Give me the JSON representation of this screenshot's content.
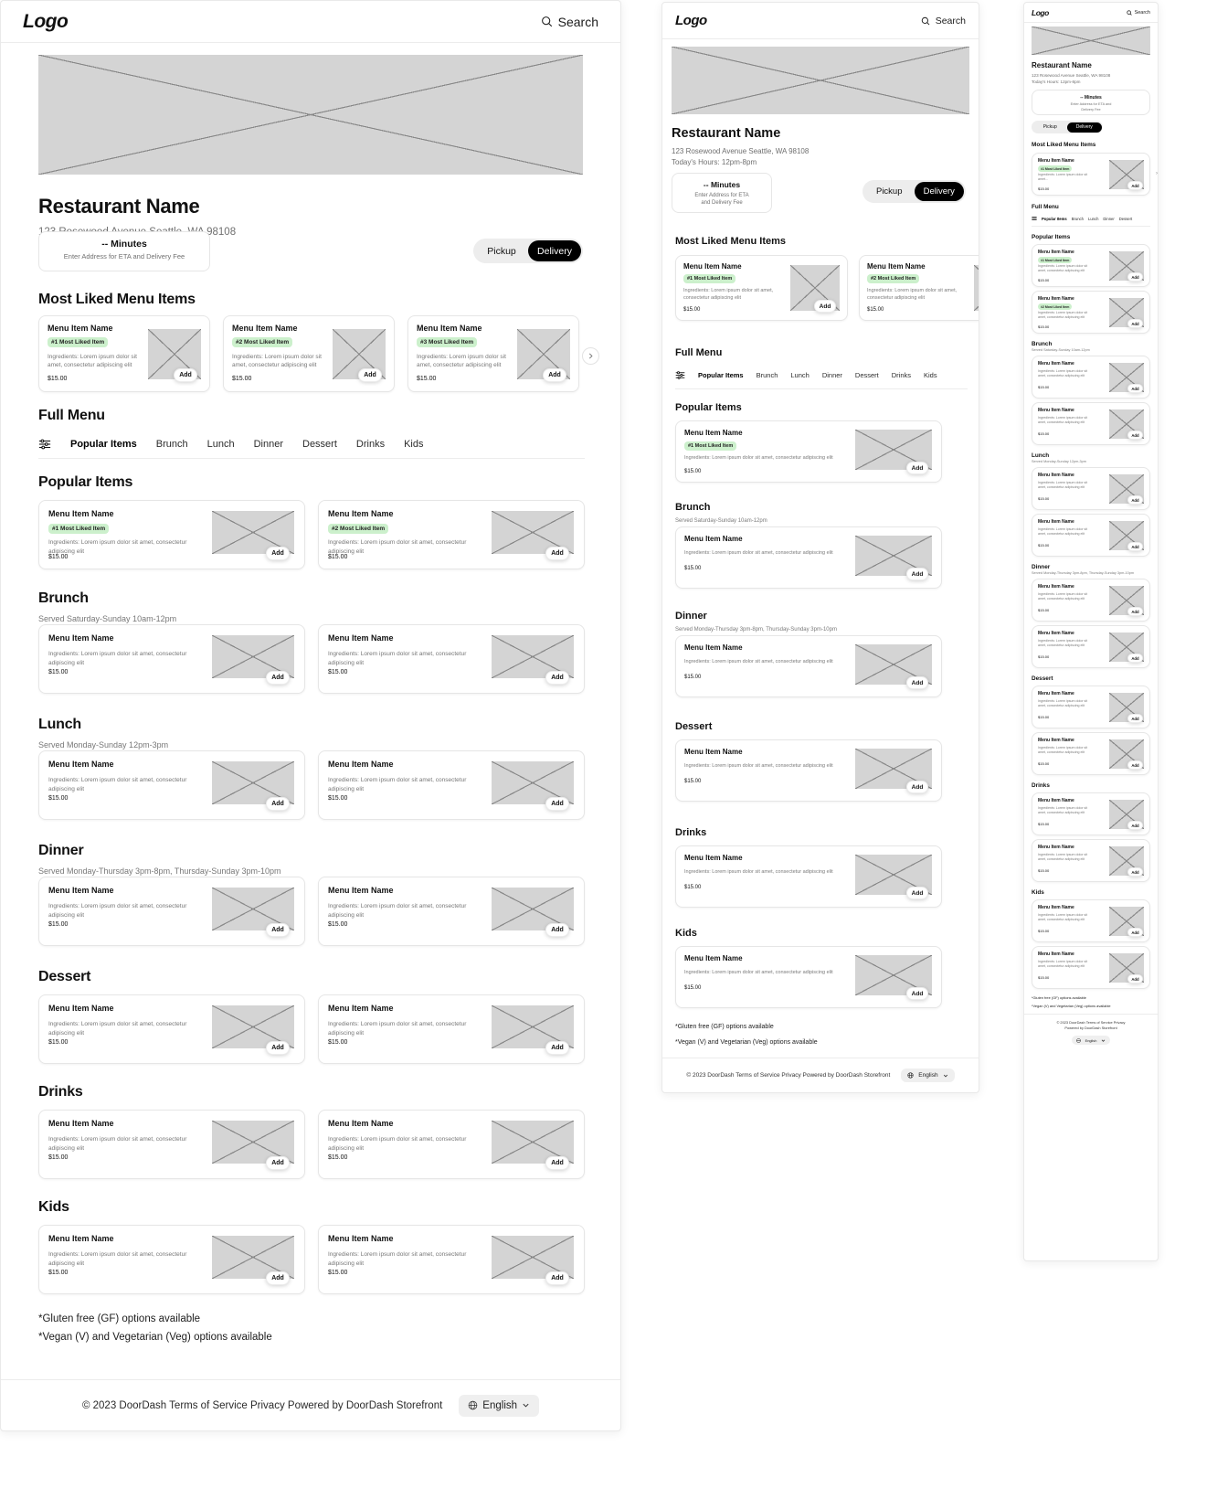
{
  "brand": {
    "logo": "Logo",
    "search_label": "Search",
    "search_icon": "search-icon"
  },
  "restaurant": {
    "name": "Restaurant Name",
    "address": "123 Rosewood Avenue Seattle, WA 98108",
    "hours": "Today's Hours: 12pm-8pm"
  },
  "eta": {
    "minutes": "-- Minutes",
    "hint": "Enter Address for ETA and Delivery Fee",
    "hint_l1": "Enter Address for ETA",
    "hint_l2": "and Delivery Fee",
    "hint_m1": "Enter Address for ETA and",
    "hint_m2": "Delivery Fee"
  },
  "fulfillment": {
    "pickup": "Pickup",
    "delivery": "Delivery",
    "selected": "Delivery"
  },
  "sections": {
    "most_liked_title": "Most Liked Menu Items",
    "full_menu_title": "Full Menu"
  },
  "filter_icon": "filter-sliders-icon",
  "tabs": [
    {
      "label": "Popular Items",
      "active": true
    },
    {
      "label": "Brunch",
      "active": false
    },
    {
      "label": "Lunch",
      "active": false
    },
    {
      "label": "Dinner",
      "active": false
    },
    {
      "label": "Dessert",
      "active": false
    },
    {
      "label": "Drinks",
      "active": false
    },
    {
      "label": "Kids",
      "active": false
    }
  ],
  "item": {
    "name": "Menu Item Name",
    "ingredients": "Ingredients: Lorem ipsum dolor sit amet, consectetur adipiscing elit",
    "ingredients_truncated": "Ingredients: Lorem ipsum dolor sit amet...",
    "price": "$15.00",
    "add_label": "Add"
  },
  "badges": {
    "first": "#1 Most Liked Item",
    "second": "#2 Most Liked Item",
    "third": "#3 Most Liked Item"
  },
  "most_liked": [
    {
      "name": "Menu Item Name",
      "badge": "#1 Most Liked Item",
      "ingredients": "Ingredients: Lorem ipsum dolor sit amet, consectetur adipiscing elit",
      "price": "$15.00"
    },
    {
      "name": "Menu Item Name",
      "badge": "#2 Most Liked Item",
      "ingredients": "Ingredients: Lorem ipsum dolor sit amet, consectetur adipiscing elit",
      "price": "$15.00"
    },
    {
      "name": "Menu Item Name",
      "badge": "#3 Most Liked Item",
      "ingredients": "Ingredients: Lorem ipsum dolor sit amet, consectetur adipiscing elit",
      "price": "$15.00"
    }
  ],
  "menu_sections": [
    {
      "title": "Popular Items",
      "subtitle": "",
      "items": [
        {
          "name": "Menu Item Name",
          "badge": "#1 Most Liked Item",
          "ingredients": "Ingredients: Lorem ipsum dolor sit amet, consectetur adipiscing elit",
          "price": "$15.00"
        },
        {
          "name": "Menu Item Name",
          "badge": "#2 Most Liked Item",
          "ingredients": "Ingredients: Lorem ipsum dolor sit amet, consectetur adipiscing elit",
          "price": "$15.00"
        }
      ]
    },
    {
      "title": "Brunch",
      "subtitle": "Served Saturday-Sunday 10am-12pm",
      "items": [
        {
          "name": "Menu Item Name",
          "badge": "",
          "ingredients": "Ingredients: Lorem ipsum dolor sit amet, consectetur adipiscing elit",
          "price": "$15.00"
        },
        {
          "name": "Menu Item Name",
          "badge": "",
          "ingredients": "Ingredients: Lorem ipsum dolor sit amet, consectetur adipiscing elit",
          "price": "$15.00"
        }
      ]
    },
    {
      "title": "Lunch",
      "subtitle": "Served Monday-Sunday 12pm-3pm",
      "items": [
        {
          "name": "Menu Item Name",
          "badge": "",
          "ingredients": "Ingredients: Lorem ipsum dolor sit amet, consectetur adipiscing elit",
          "price": "$15.00"
        },
        {
          "name": "Menu Item Name",
          "badge": "",
          "ingredients": "Ingredients: Lorem ipsum dolor sit amet, consectetur adipiscing elit",
          "price": "$15.00"
        }
      ]
    },
    {
      "title": "Dinner",
      "subtitle": "Served Monday-Thursday 3pm-8pm, Thursday-Sunday 3pm-10pm",
      "items": [
        {
          "name": "Menu Item Name",
          "badge": "",
          "ingredients": "Ingredients: Lorem ipsum dolor sit amet, consectetur adipiscing elit",
          "price": "$15.00"
        },
        {
          "name": "Menu Item Name",
          "badge": "",
          "ingredients": "Ingredients: Lorem ipsum dolor sit amet, consectetur adipiscing elit",
          "price": "$15.00"
        }
      ]
    },
    {
      "title": "Dessert",
      "subtitle": "",
      "items": [
        {
          "name": "Menu Item Name",
          "badge": "",
          "ingredients": "Ingredients: Lorem ipsum dolor sit amet, consectetur adipiscing elit",
          "price": "$15.00"
        },
        {
          "name": "Menu Item Name",
          "badge": "",
          "ingredients": "Ingredients: Lorem ipsum dolor sit amet, consectetur adipiscing elit",
          "price": "$15.00"
        }
      ]
    },
    {
      "title": "Drinks",
      "subtitle": "",
      "items": [
        {
          "name": "Menu Item Name",
          "badge": "",
          "ingredients": "Ingredients: Lorem ipsum dolor sit amet, consectetur adipiscing elit",
          "price": "$15.00"
        },
        {
          "name": "Menu Item Name",
          "badge": "",
          "ingredients": "Ingredients: Lorem ipsum dolor sit amet, consectetur adipiscing elit",
          "price": "$15.00"
        }
      ]
    },
    {
      "title": "Kids",
      "subtitle": "",
      "items": [
        {
          "name": "Menu Item Name",
          "badge": "",
          "ingredients": "Ingredients: Lorem ipsum dolor sit amet, consectetur adipiscing elit",
          "price": "$15.00"
        },
        {
          "name": "Menu Item Name",
          "badge": "",
          "ingredients": "Ingredients: Lorem ipsum dolor sit amet, consectetur adipiscing elit",
          "price": "$15.00"
        }
      ]
    }
  ],
  "notes": {
    "gluten": "*Gluten free (GF) options available",
    "vegan": "*Vegan (V) and Vegetarian (Veg) options available"
  },
  "footer": {
    "copyright": "© 2023 DoorDash Terms of Service Privacy Powered by DoorDash Storefront",
    "copyright_l1": "© 2023 DoorDash Terms of Service Privacy",
    "copyright_l2": "Powered by DoorDash Storefront",
    "language": "English",
    "globe_icon": "globe-icon",
    "chevron_icon": "chevron-down-icon"
  },
  "colors": {
    "accent_badge_bg": "#ccf0cc",
    "selected_toggle_bg": "#000000",
    "placeholder_gray": "#d4d4d4"
  }
}
